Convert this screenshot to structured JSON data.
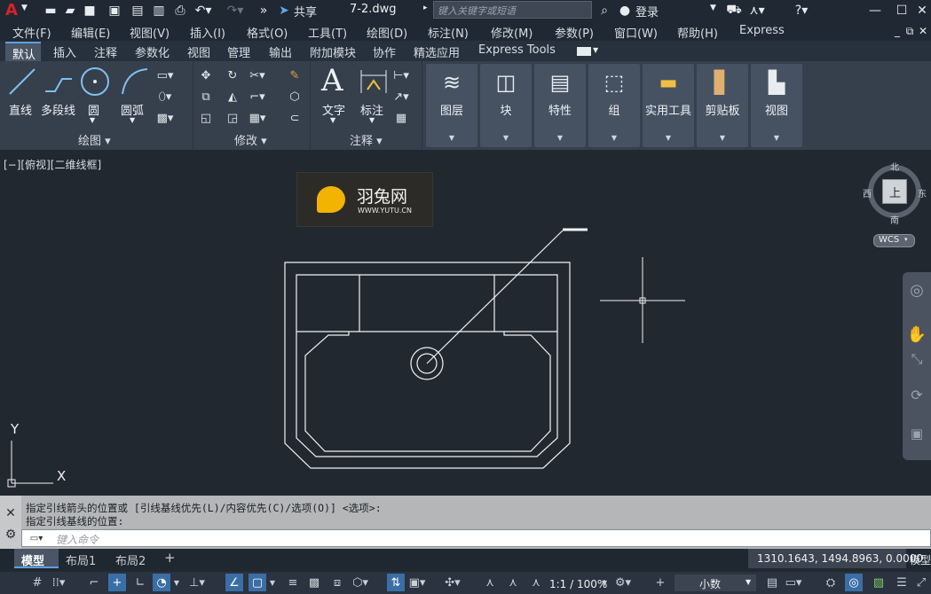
{
  "app": {
    "logo": "A",
    "filename": "7-2.dwg",
    "search_placeholder": "键入关键字或短语",
    "share": "共享",
    "login": "登录"
  },
  "menu": [
    "文件(F)",
    "编辑(E)",
    "视图(V)",
    "插入(I)",
    "格式(O)",
    "工具(T)",
    "绘图(D)",
    "标注(N)",
    "修改(M)",
    "参数(P)",
    "窗口(W)",
    "帮助(H)",
    "Express"
  ],
  "ribbon_tabs": [
    "默认",
    "插入",
    "注释",
    "参数化",
    "视图",
    "管理",
    "输出",
    "附加模块",
    "协作",
    "精选应用",
    "Express Tools"
  ],
  "active_tab": "默认",
  "draw_panel": {
    "title": "绘图",
    "tools": [
      "直线",
      "多段线",
      "圆",
      "圆弧"
    ]
  },
  "modify_panel": {
    "title": "修改"
  },
  "annotation_panel": {
    "title": "注释",
    "tools": [
      "文字",
      "标注"
    ]
  },
  "big_buttons": [
    "图层",
    "块",
    "特性",
    "组",
    "实用工具",
    "剪贴板",
    "视图"
  ],
  "viewport_label": "[−][俯视][二维线框]",
  "watermark": {
    "brand": "羽兔网",
    "url": "WWW.YUTU.CN"
  },
  "viewcube": {
    "north": "北",
    "south": "南",
    "east": "东",
    "west": "西",
    "face": "上",
    "wcs": "WCS"
  },
  "ucs": {
    "x": "X",
    "y": "Y"
  },
  "command": {
    "line1": "指定引线箭头的位置或 [引线基线优先(L)/内容优先(C)/选项(O)] <选项>:",
    "line2": "指定引线基线的位置:",
    "input_placeholder": "键入命令"
  },
  "layout_tabs": [
    "模型",
    "布局1",
    "布局2"
  ],
  "add_tab": "+",
  "coords": "1310.1643, 1494.8963, 0.0000",
  "mode": "模型",
  "scale": "1:1 / 100%",
  "units": "小数",
  "colors": {
    "accent": "#3a6ea5",
    "canvas": "#212830",
    "ribbon": "#363f4c",
    "logo_red": "#d4232b"
  }
}
